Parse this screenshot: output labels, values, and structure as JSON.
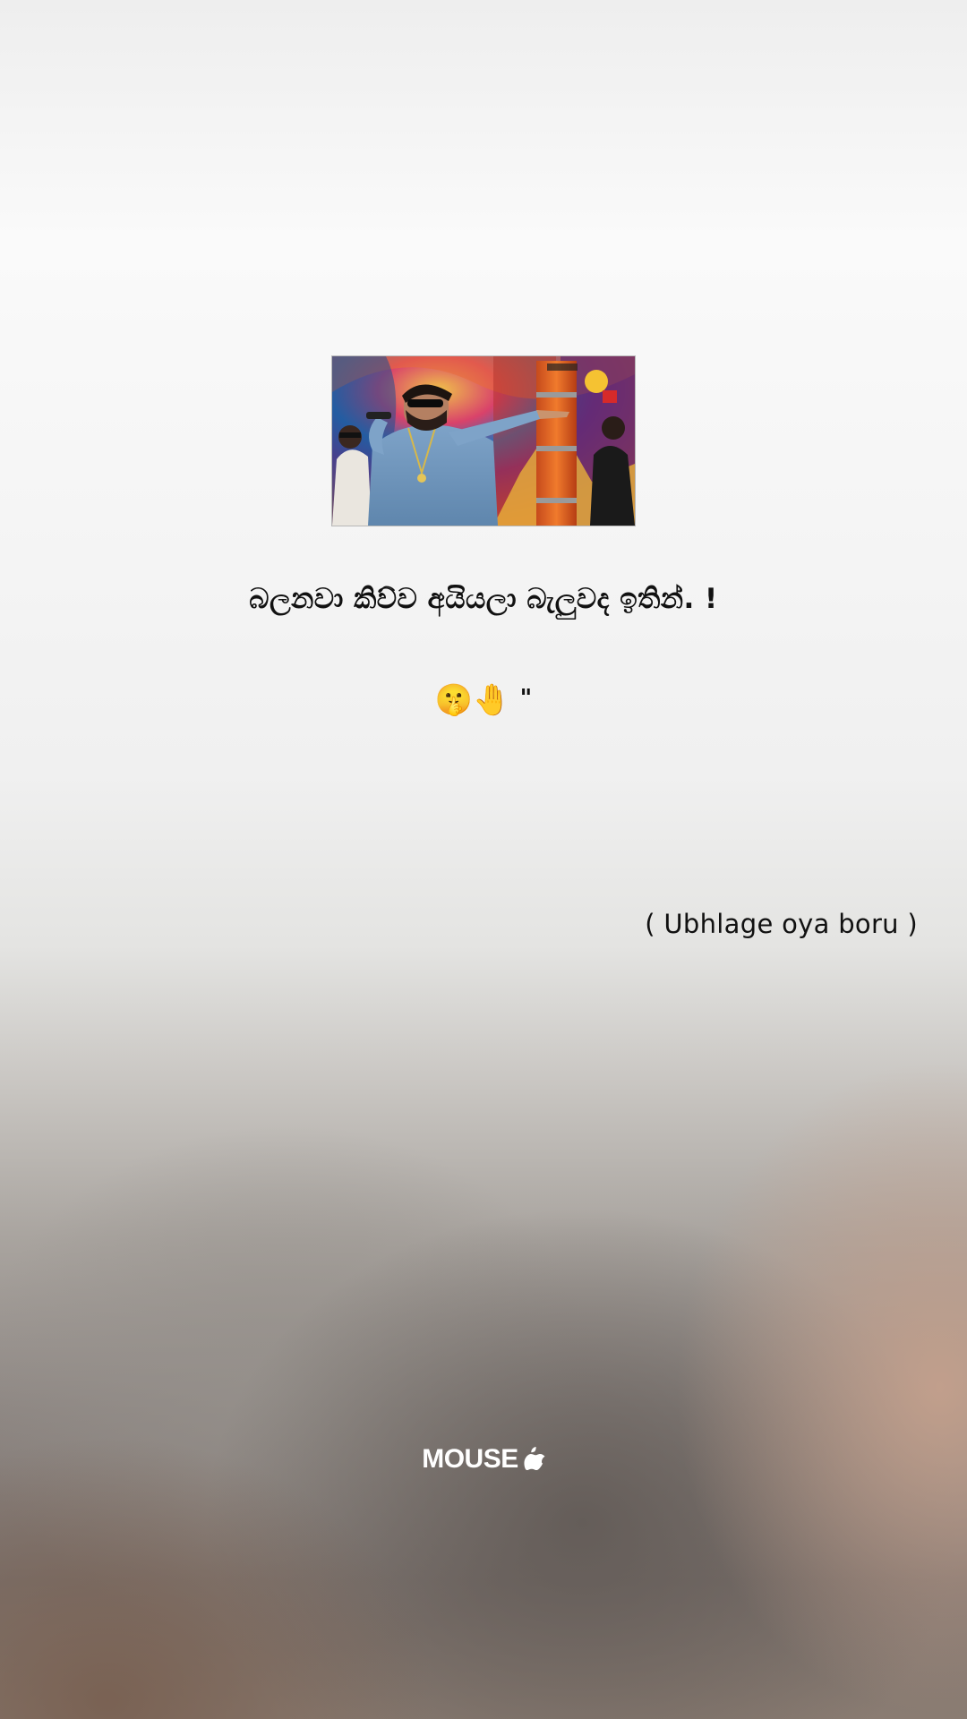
{
  "post": {
    "image_alt": "Performer in blue denim shirt with microphone on a colorful TV stage",
    "caption": "බලනවා කිව්ව අයියලා බැලුවද ඉතින්. !",
    "emoji_row": {
      "emojis": [
        "🤫",
        "🤚"
      ],
      "trailing_mark": "\""
    },
    "translation": "( Ubhlage oya boru )"
  },
  "branding": {
    "label": "MOUSE",
    "icon": "apple-icon"
  },
  "colors": {
    "text": "#111111",
    "brand_text": "#ffffff"
  }
}
